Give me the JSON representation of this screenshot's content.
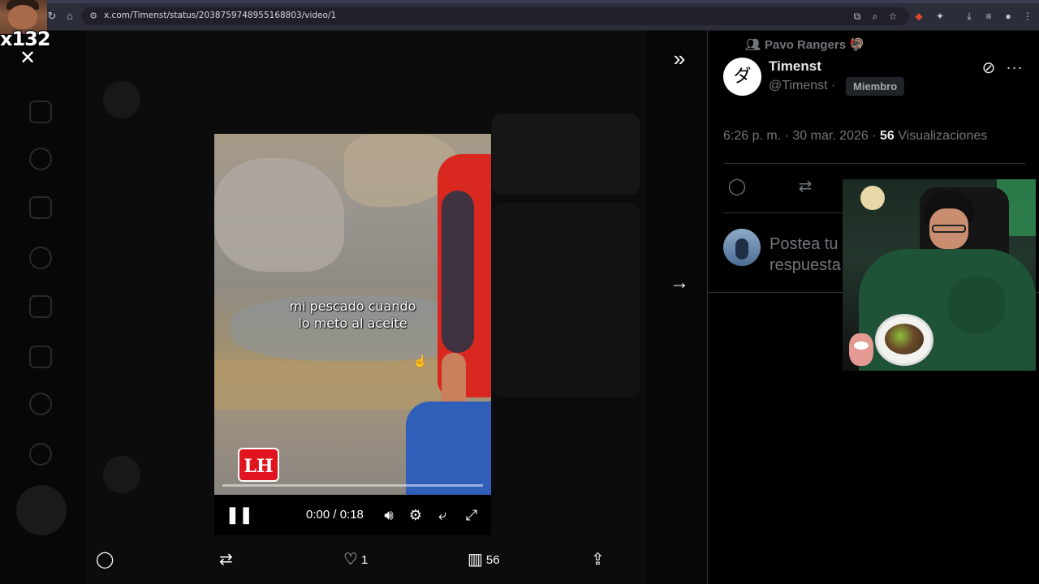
{
  "browser": {
    "url": "x.com/Timenst/status/2038759748955168803/video/1"
  },
  "overlay": {
    "multiplier": "x132"
  },
  "viewer": {
    "close_glyph": "✕",
    "expand_glyph": "»",
    "next_glyph": "→"
  },
  "video": {
    "caption_line1": "mi pescado cuando",
    "caption_line2": "lo meto al aceite",
    "logo": "LH",
    "progress": 0.0,
    "time": "0:00 / 0:18"
  },
  "actions": {
    "likes": "1",
    "views": "56"
  },
  "tweet": {
    "community": "Pavo Rangers 🦃",
    "author_name": "Timenst",
    "author_handle": "@Timenst ·",
    "badge": "Miembro",
    "avatar_glyph": "ダ",
    "timestamp": "6:26 p. m. · 30 mar. 2026 ·",
    "views_count": "56",
    "views_label": "Visualizaciones",
    "reply_placeholder": "Postea tu respuesta"
  },
  "colors": {
    "accent": "#1d9bf0",
    "muted": "#71767b",
    "text": "#e7e9ea",
    "logo_red": "#e0141e"
  },
  "icons": {
    "reply": "reply-icon",
    "repost": "repost-icon",
    "like": "heart-icon",
    "views": "views-icon",
    "share": "share-icon",
    "grok": "grok-icon",
    "more": "more-icon"
  }
}
